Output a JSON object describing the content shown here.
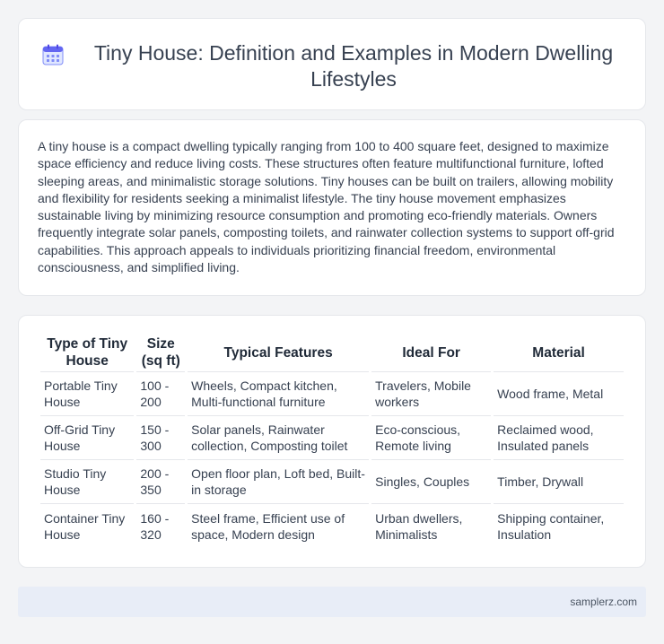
{
  "header": {
    "title": "Tiny House: Definition and Examples in Modern Dwelling Lifestyles",
    "icon": "calendar-icon",
    "icon_color": "#6366f1"
  },
  "description": "A tiny house is a compact dwelling typically ranging from 100 to 400 square feet, designed to maximize space efficiency and reduce living costs. These structures often feature multifunctional furniture, lofted sleeping areas, and minimalistic storage solutions. Tiny houses can be built on trailers, allowing mobility and flexibility for residents seeking a minimalist lifestyle. The tiny house movement emphasizes sustainable living by minimizing resource consumption and promoting eco-friendly materials. Owners frequently integrate solar panels, composting toilets, and rainwater collection systems to support off-grid capabilities. This approach appeals to individuals prioritizing financial freedom, environmental consciousness, and simplified living.",
  "table": {
    "headers": [
      "Type of Tiny House",
      "Size (sq ft)",
      "Typical Features",
      "Ideal For",
      "Material"
    ],
    "rows": [
      [
        "Portable Tiny House",
        "100 - 200",
        "Wheels, Compact kitchen, Multi-functional furniture",
        "Travelers, Mobile workers",
        "Wood frame, Metal"
      ],
      [
        "Off-Grid Tiny House",
        "150 - 300",
        "Solar panels, Rainwater collection, Composting toilet",
        "Eco-conscious, Remote living",
        "Reclaimed wood, Insulated panels"
      ],
      [
        "Studio Tiny House",
        "200 - 350",
        "Open floor plan, Loft bed, Built-in storage",
        "Singles, Couples",
        "Timber, Drywall"
      ],
      [
        "Container Tiny House",
        "160 - 320",
        "Steel frame, Efficient use of space, Modern design",
        "Urban dwellers, Minimalists",
        "Shipping container, Insulation"
      ]
    ]
  },
  "footer": {
    "text": "samplerz.com"
  }
}
